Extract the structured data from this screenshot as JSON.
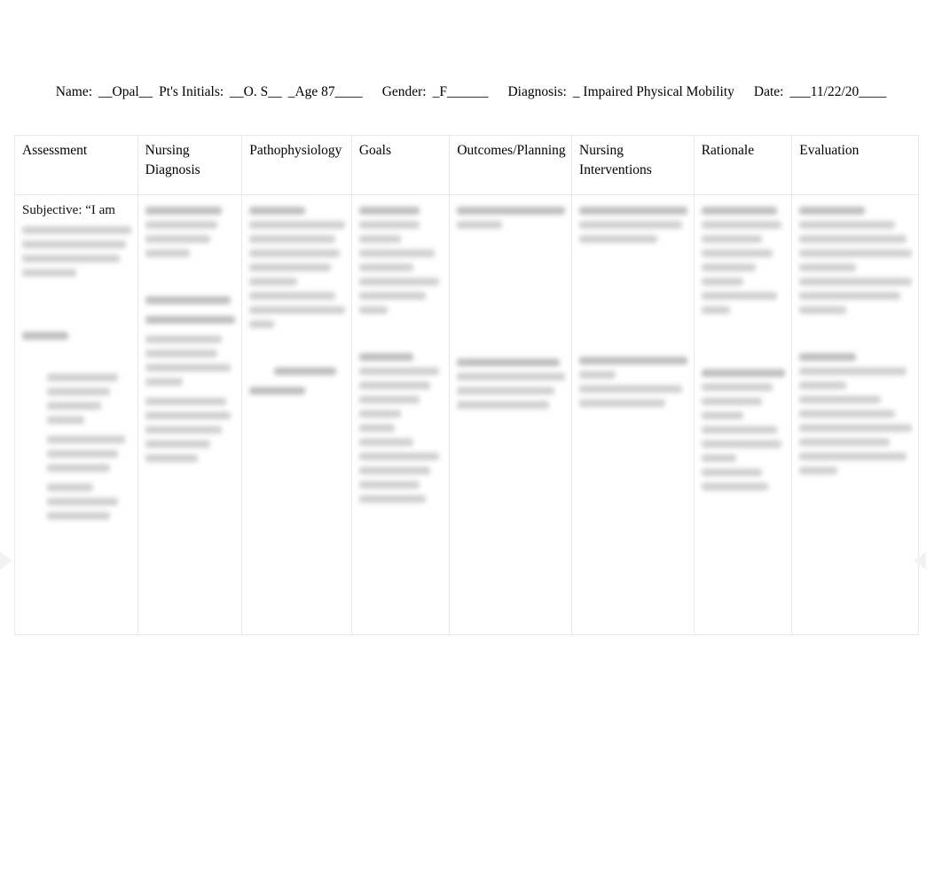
{
  "document": {
    "kind": "nursing-care-plan-worksheet",
    "page_background": "#ffffff"
  },
  "patient_header": {
    "name_label": "Name:",
    "name_value": "__Opal__",
    "initials_label": "Pt's Initials:",
    "initials_value": "__O. S__",
    "age_value": "_Age 87____",
    "gender_label": "Gender:",
    "gender_value": "_F______",
    "diagnosis_label": "Diagnosis:",
    "diagnosis_value": "_ Impaired Physical Mobility",
    "date_label": "Date:",
    "date_value": "___11/22/20____"
  },
  "table": {
    "columns": [
      {
        "key": "assessment",
        "label": "Assessment"
      },
      {
        "key": "nursing_dx",
        "label": "Nursing Diagnosis"
      },
      {
        "key": "patho",
        "label": "Pathophysiology"
      },
      {
        "key": "goals",
        "label": "Goals"
      },
      {
        "key": "outcomes",
        "label": "Outcomes/Planning"
      },
      {
        "key": "interventions",
        "label": "Nursing Interventions"
      },
      {
        "key": "rationale",
        "label": "Rationale"
      },
      {
        "key": "evaluation",
        "label": "Evaluation"
      }
    ],
    "row": {
      "assessment": {
        "legible_text": "Subjective: “I am",
        "remaining_text_state": "blurred"
      },
      "nursing_dx": {
        "remaining_text_state": "blurred"
      },
      "patho": {
        "remaining_text_state": "blurred"
      },
      "goals": {
        "remaining_text_state": "blurred"
      },
      "outcomes": {
        "remaining_text_state": "blurred"
      },
      "interventions": {
        "remaining_text_state": "blurred"
      },
      "rationale": {
        "remaining_text_state": "blurred"
      },
      "evaluation": {
        "remaining_text_state": "blurred"
      }
    }
  }
}
